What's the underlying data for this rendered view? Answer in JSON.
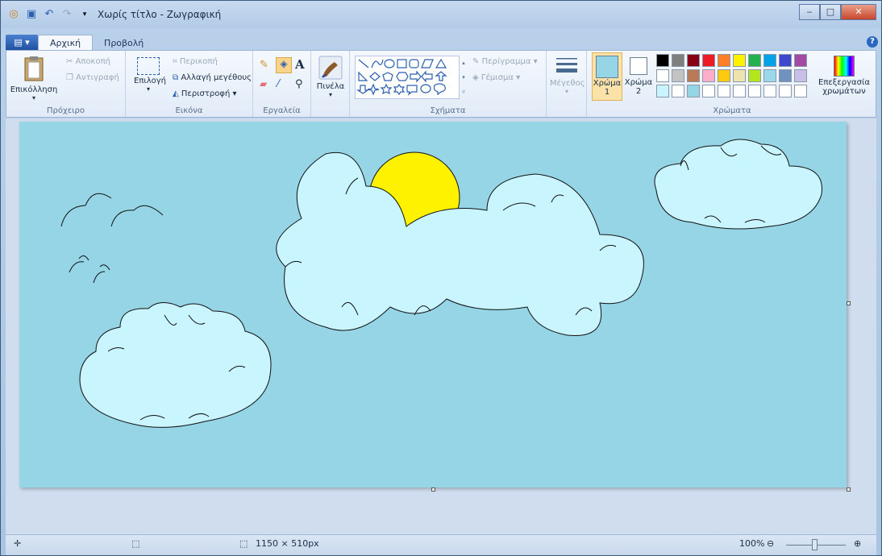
{
  "window": {
    "title": "Χωρίς τίτλο - Ζωγραφική"
  },
  "tabs": [
    "Αρχική",
    "Προβολή"
  ],
  "clipboard": {
    "paste": "Επικόλληση",
    "cut": "Αποκοπή",
    "copy": "Αντιγραφή",
    "label": "Πρόχειρο"
  },
  "image": {
    "select": "Επιλογή",
    "crop": "Περικοπή",
    "resize": "Αλλαγή μεγέθους",
    "rotate": "Περιστροφή",
    "label": "Εικόνα"
  },
  "tools": {
    "label": "Εργαλεία"
  },
  "brushes": {
    "label": "Πινέλα"
  },
  "shapes": {
    "outline": "Περίγραμμα",
    "fill": "Γέμισμα",
    "label": "Σχήματα"
  },
  "size": {
    "label": "Μέγεθος"
  },
  "colors": {
    "color1": "Χρώμα",
    "color1_num": "1",
    "color2": "Χρώμα",
    "color2_num": "2",
    "edit_line1": "Επεξεργασία",
    "edit_line2": "χρωμάτων",
    "label": "Χρώματα",
    "current1": "#95d5e6",
    "current2": "#ffffff",
    "row1": [
      "#000000",
      "#7f7f7f",
      "#880015",
      "#ed1c24",
      "#ff7f27",
      "#fff200",
      "#22b14c",
      "#00a2e8",
      "#3f48cc",
      "#a349a4"
    ],
    "row2": [
      "#ffffff",
      "#c3c3c3",
      "#b97a57",
      "#ffaec9",
      "#ffc90e",
      "#efe4b0",
      "#b5e61d",
      "#99d9ea",
      "#7092be",
      "#c8bfe7"
    ],
    "row3": [
      "#c8f5ff",
      "#ffffff",
      "#95d5e6",
      "#ffffff",
      "#ffffff",
      "#ffffff",
      "#ffffff",
      "#ffffff",
      "#ffffff",
      "#ffffff"
    ]
  },
  "status": {
    "dimensions": "1150 × 510px",
    "zoom": "100%"
  }
}
